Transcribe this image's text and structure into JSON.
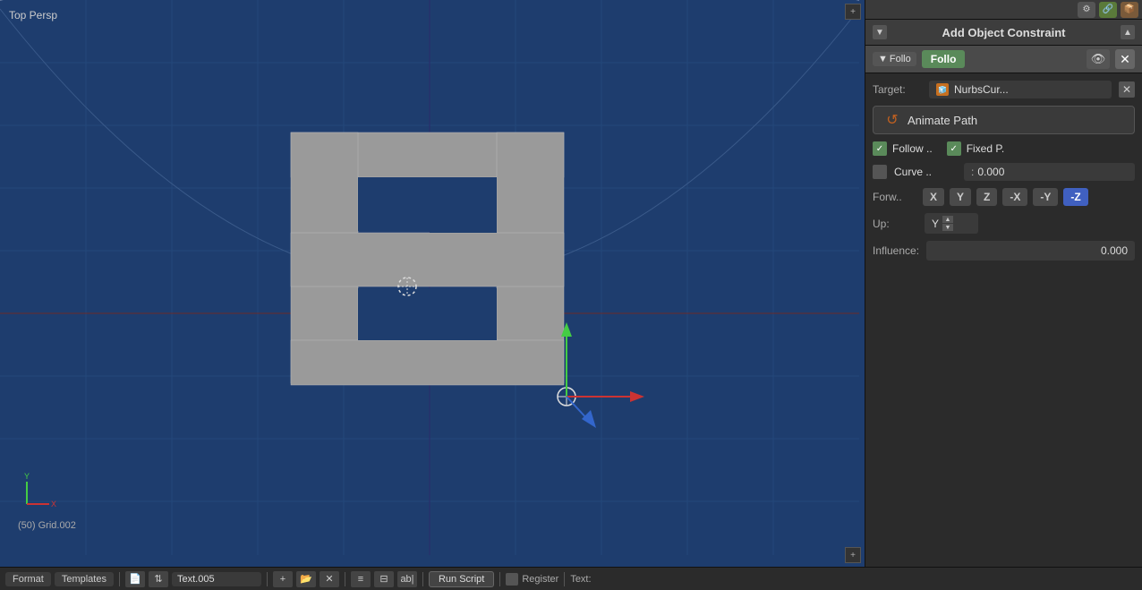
{
  "viewport": {
    "label": "Top Persp",
    "coord_label": "(50) Grid.002"
  },
  "panel": {
    "title": "Add Object Constraint",
    "constraint_short1": "Follo",
    "constraint_short2": "Follo",
    "target_label": "Target:",
    "target_value": "NurbsCur...",
    "animate_path": "Animate Path",
    "follow_label": "Follow ..",
    "fixed_p_label": "Fixed P.",
    "curve_label": "Curve ..",
    "curve_value": "0.000",
    "forw_label": "Forw..",
    "axis_x": "X",
    "axis_y": "Y",
    "axis_z": "Z",
    "axis_nx": "-X",
    "axis_ny": "-Y",
    "axis_nz": "-Z",
    "up_label": "Up:",
    "up_value": "Y",
    "influence_label": "Influence:",
    "influence_value": "0.000"
  },
  "bottom_bar": {
    "format_tab": "Format",
    "templates_tab": "Templates",
    "text_field_value": "Text.005",
    "run_script_label": "Run Script",
    "register_label": "Register",
    "text_label": "Text:"
  }
}
